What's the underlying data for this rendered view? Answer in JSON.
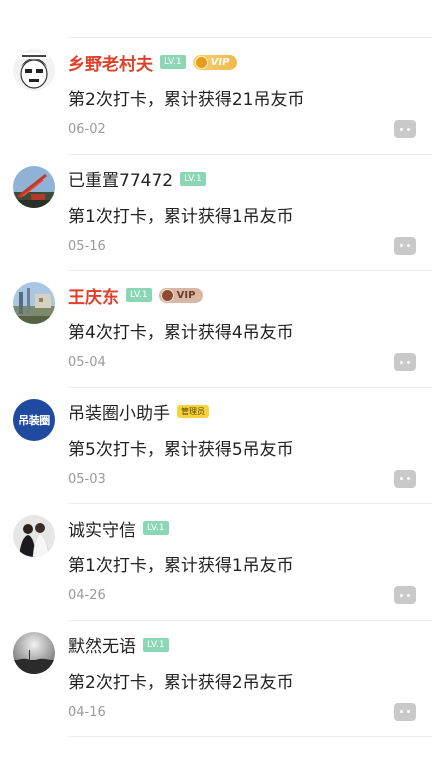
{
  "feed": {
    "items": [
      {
        "name": "乡野老村夫",
        "level": "LV.1",
        "vip": "VIP",
        "text": "第2次打卡，累计获得21吊友币",
        "date": "06-02"
      },
      {
        "name": "已重置77472",
        "level": "LV.1",
        "text": "第1次打卡，累计获得1吊友币",
        "date": "05-16"
      },
      {
        "name": "王庆东",
        "level": "LV.1",
        "vip": "VIP",
        "text": "第4次打卡，累计获得4吊友币",
        "date": "05-04"
      },
      {
        "name": "吊装圈小助手",
        "badge": "管理员",
        "avatar_text": "吊装圈",
        "text": "第5次打卡，累计获得5吊友币",
        "date": "05-03"
      },
      {
        "name": "诚实守信",
        "level": "LV.1",
        "text": "第1次打卡，累计获得1吊友币",
        "date": "04-26"
      },
      {
        "name": "默然无语",
        "level": "LV.1",
        "text": "第2次打卡，累计获得2吊友币",
        "date": "04-16"
      }
    ]
  },
  "colors": {
    "vip_name": "#e0402a",
    "level_badge": "#8ad6b5",
    "divider": "#ececec",
    "date_text": "#9a9a9a",
    "admin_avatar": "#1f4aa0"
  },
  "icons": {
    "comment": "comment-bubble-icon"
  }
}
